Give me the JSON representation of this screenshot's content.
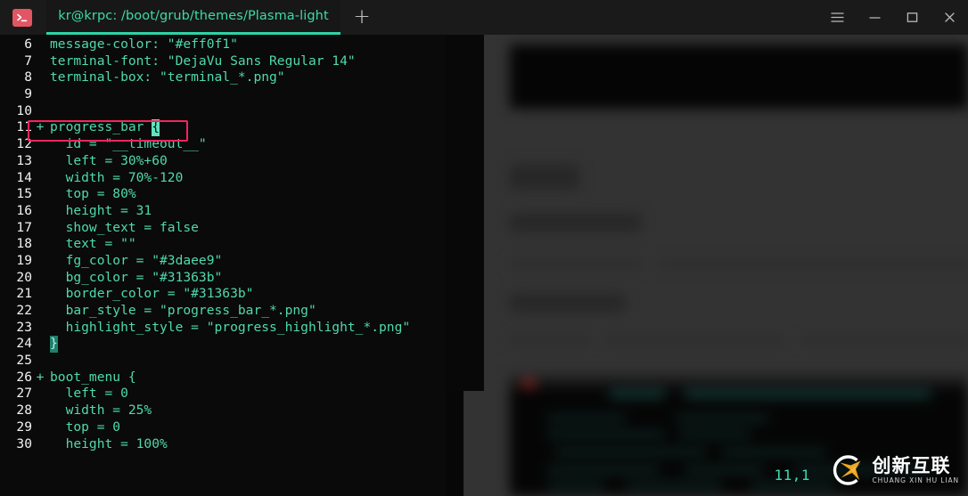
{
  "window": {
    "app_icon": "terminal-icon",
    "tab_title": "kr@krpc: /boot/grub/themes/Plasma-light",
    "new_tab_label": "+",
    "controls": {
      "menu": "hamburger-menu-icon",
      "minimize": "minimize-icon",
      "maximize": "maximize-icon",
      "close": "close-icon"
    },
    "accent_color": "#2ed3a7",
    "icon_color": "#e25563"
  },
  "editor": {
    "text_color": "#4fd9ae",
    "linenum_color": "#f2f2f2",
    "background": "#0a0a0a",
    "highlight_border_color": "#f5245f",
    "cursor_position": "11,1",
    "lines": [
      {
        "num": "6",
        "sign": "",
        "text": "message-color: \"#eff0f1\""
      },
      {
        "num": "7",
        "sign": "",
        "text": "terminal-font: \"DejaVu Sans Regular 14\""
      },
      {
        "num": "8",
        "sign": "",
        "text": "terminal-box: \"terminal_*.png\""
      },
      {
        "num": "9",
        "sign": "",
        "text": ""
      },
      {
        "num": "10",
        "sign": "",
        "text": ""
      },
      {
        "num": "11",
        "sign": "+",
        "text": "progress_bar ",
        "cursor": "{",
        "highlight": true
      },
      {
        "num": "12",
        "sign": "",
        "text": "  id = \"__timeout__\""
      },
      {
        "num": "13",
        "sign": "",
        "text": "  left = 30%+60"
      },
      {
        "num": "14",
        "sign": "",
        "text": "  width = 70%-120"
      },
      {
        "num": "15",
        "sign": "",
        "text": "  top = 80%"
      },
      {
        "num": "16",
        "sign": "",
        "text": "  height = 31"
      },
      {
        "num": "17",
        "sign": "",
        "text": "  show_text = false"
      },
      {
        "num": "18",
        "sign": "",
        "text": "  text = \"\""
      },
      {
        "num": "19",
        "sign": "",
        "text": "  fg_color = \"#3daee9\""
      },
      {
        "num": "20",
        "sign": "",
        "text": "  bg_color = \"#31363b\""
      },
      {
        "num": "21",
        "sign": "",
        "text": "  border_color = \"#31363b\""
      },
      {
        "num": "22",
        "sign": "",
        "text": "  bar_style = \"progress_bar_*.png\""
      },
      {
        "num": "23",
        "sign": "",
        "text": "  highlight_style = \"progress_highlight_*.png\""
      },
      {
        "num": "24",
        "sign": "",
        "text": "",
        "brace": "}"
      },
      {
        "num": "25",
        "sign": "",
        "text": ""
      },
      {
        "num": "26",
        "sign": "+",
        "text": "boot_menu {"
      },
      {
        "num": "27",
        "sign": "",
        "text": "  left = 0"
      },
      {
        "num": "28",
        "sign": "",
        "text": "  width = 25%"
      },
      {
        "num": "29",
        "sign": "",
        "text": "  top = 0"
      },
      {
        "num": "30",
        "sign": "",
        "text": "  height = 100%"
      }
    ]
  },
  "watermark": {
    "logo": "chuangxin-hulian-logo-icon",
    "name_cn": "创新互联",
    "name_en": "CHUANG XIN HU LIAN",
    "mark_color": "#f0a81e"
  }
}
